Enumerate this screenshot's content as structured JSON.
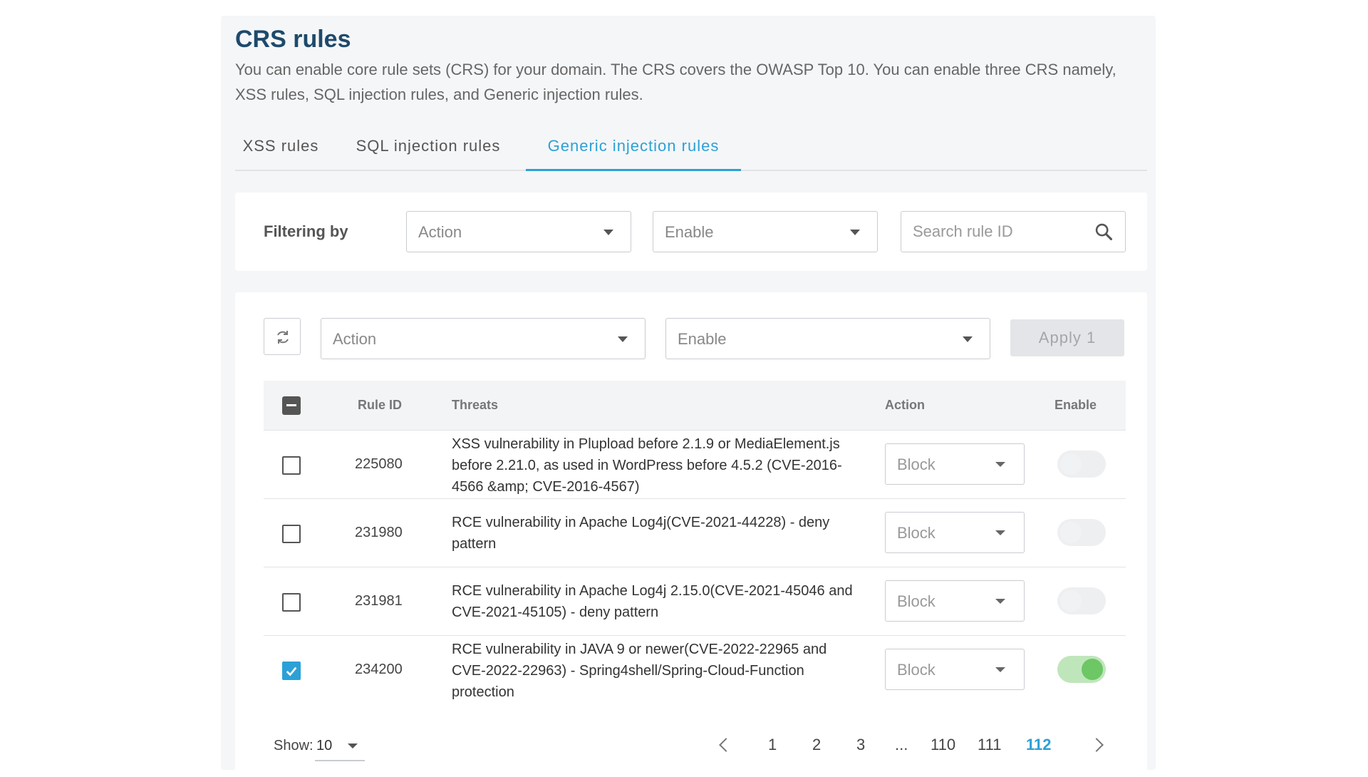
{
  "header": {
    "title": "CRS rules",
    "description": "You can enable core rule sets (CRS) for your domain. The CRS covers the OWASP Top 10. You can enable three CRS namely, XSS rules, SQL injection rules, and Generic injection rules."
  },
  "tabs": [
    {
      "label": "XSS rules"
    },
    {
      "label": "SQL injection rules"
    },
    {
      "label": "Generic injection rules",
      "active": true
    }
  ],
  "filter": {
    "label": "Filtering by",
    "action_select": "Action",
    "enable_select": "Enable",
    "search_placeholder": "Search rule ID"
  },
  "bulk": {
    "action_select": "Action",
    "enable_select": "Enable",
    "apply_label": "Apply 1"
  },
  "table": {
    "columns": {
      "rule_id": "Rule ID",
      "threats": "Threats",
      "action": "Action",
      "enable": "Enable"
    },
    "rows": [
      {
        "rule_id": "225080",
        "threats": "XSS vulnerability in Plupload before 2.1.9 or MediaElement.js before 2.21.0, as used in WordPress before 4.5.2 (CVE-2016-4566 &amp; CVE-2016-4567)",
        "action": "Block",
        "checked": false,
        "enabled": false
      },
      {
        "rule_id": "231980",
        "threats": "RCE vulnerability in Apache Log4j(CVE-2021-44228) - deny pattern",
        "action": "Block",
        "checked": false,
        "enabled": false
      },
      {
        "rule_id": "231981",
        "threats": "RCE vulnerability in Apache Log4j 2.15.0(CVE-2021-45046 and CVE-2021-45105) - deny pattern",
        "action": "Block",
        "checked": false,
        "enabled": false
      },
      {
        "rule_id": "234200",
        "threats": "RCE vulnerability in JAVA 9 or newer(CVE-2022-22965 and CVE-2022-22963) - Spring4shell/Spring-Cloud-Function protection",
        "action": "Block",
        "checked": true,
        "enabled": true
      }
    ]
  },
  "pagination": {
    "show_label": "Show:",
    "page_size": "10",
    "pages": [
      "1",
      "2",
      "3",
      "...",
      "110",
      "111",
      "112"
    ],
    "current": "112"
  },
  "colors": {
    "accent": "#2ca1d6",
    "title": "#1e4a6b",
    "toggle_on": "#6cc764"
  }
}
